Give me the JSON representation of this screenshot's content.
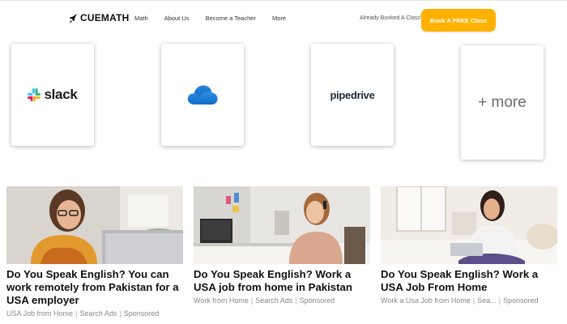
{
  "header": {
    "brand": "CUEMATH",
    "nav": [
      "Math",
      "About Us",
      "Become a Teacher",
      "More"
    ],
    "already_booked": "Already Booked A Class?",
    "cta_label": "Book A FREE Class"
  },
  "integrations": {
    "slack": "slack",
    "pipedrive": "pipedrive",
    "more": "+ more"
  },
  "ads": [
    {
      "title": "Do You Speak English? You can work remotely from Pakistan for a USA employer",
      "source": "USA Job from Home",
      "provider": "Search Ads",
      "label": "Sponsored"
    },
    {
      "title": "Do You Speak English? Work a USA job from home in Pakistan",
      "source": "Work from Home",
      "provider": "Search Ads",
      "label": "Sponsored"
    },
    {
      "title": "Do You Speak English? Work a USA Job From Home",
      "source": "Work a Usa Job from Home",
      "provider": "Sea...",
      "label": "Sponsored"
    }
  ],
  "colors": {
    "cta": "#ffb100",
    "slack_blue": "#36c5f0",
    "slack_green": "#2eb67d",
    "slack_yellow": "#ecb22e",
    "slack_red": "#e01e5a",
    "onedrive_blue": "#0f78d4"
  }
}
